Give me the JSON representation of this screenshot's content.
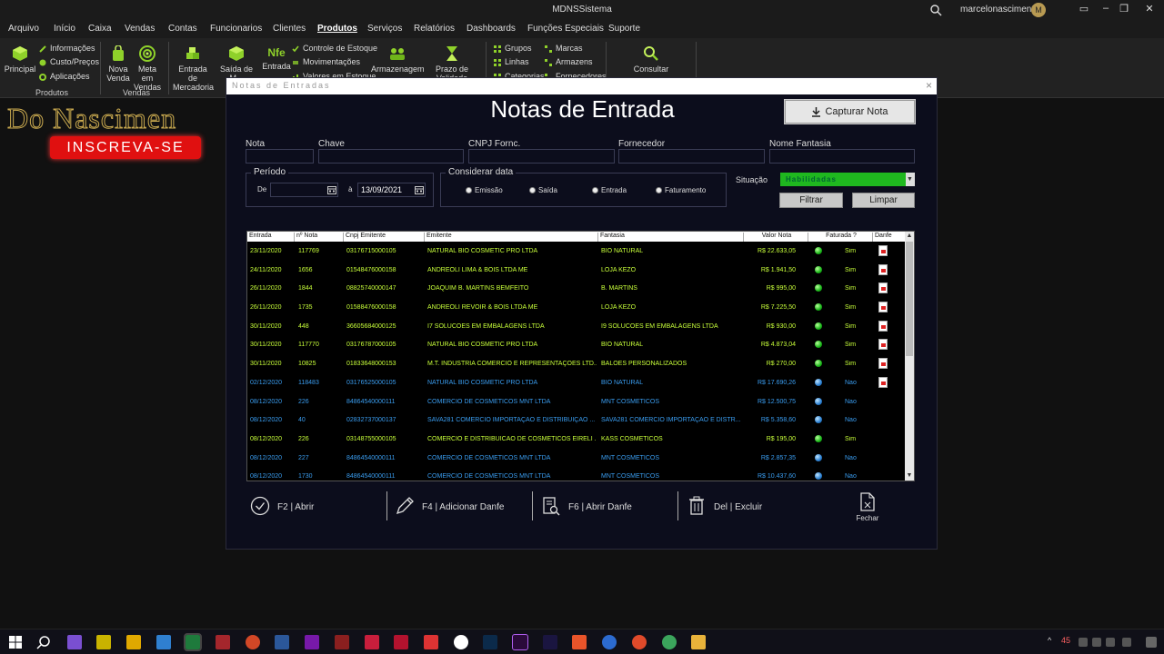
{
  "window": {
    "title": "MDNSSistema",
    "user": "marcelonascimento",
    "avatar_initial": "M",
    "minimize": "–",
    "restore": "❒",
    "close": "✕"
  },
  "menu": [
    "Arquivo",
    "Início",
    "Caixa",
    "Vendas",
    "Contas",
    "Funcionarios",
    "Clientes",
    "Produtos",
    "Serviços",
    "Relatórios",
    "Dashboards",
    "Funções Especiais",
    "Suporte"
  ],
  "menu_active": "Produtos",
  "ribbon": {
    "principal": "Principal",
    "informacoes": "Informações",
    "custo_precos": "Custo/Preços",
    "aplicacoes": "Aplicações",
    "group_produtos": "Produtos",
    "nova_venda": "Nova Venda",
    "meta_vendas": "Meta em Vendas",
    "group_vendas": "Vendas",
    "entrada_mercadoria": "Entrada de Mercadoria",
    "saida_mercadoria": "Saída de M...",
    "nfe_badge": "Nfe",
    "entrada_nfe": "Entrada",
    "controle_estoque": "Controle de Estoque",
    "movimentacoes": "Movimentações",
    "valores_estoque": "Valores em Estoque",
    "armazenagem": "Armazenagem",
    "prazo_validade": "Prazo de Validade",
    "grupos": "Grupos",
    "linhas": "Linhas",
    "categorias": "Categorias",
    "marcas": "Marcas",
    "armazens": "Armazens",
    "fornecedores": "Fornecedores",
    "consultar": "Consultar"
  },
  "banner": {
    "text": "Do Nascimen",
    "button": "INSCREVA-SE"
  },
  "modal": {
    "title": "Notas de Entradas",
    "heading": "Notas de Entrada",
    "capture_button": "Capturar Nota",
    "close": "×"
  },
  "filters": {
    "nota_label": "Nota",
    "chave_label": "Chave",
    "cnpj_label": "CNPJ Fornc.",
    "fornecedor_label": "Fornecedor",
    "nome_fantasia_label": "Nome Fantasia",
    "periodo_legend": "Período",
    "de_label": "De",
    "ate_label": "à",
    "date_from": "",
    "date_to": "13/09/2021",
    "considerar_legend": "Considerar data",
    "radio_emissao": "Emissão",
    "radio_saida": "Saída",
    "radio_entrada": "Entrada",
    "radio_faturamento": "Faturamento",
    "situacao_label": "Situação",
    "situacao_value": "Habilidadas",
    "filtrar": "Filtrar",
    "limpar": "Limpar"
  },
  "grid": {
    "columns": [
      "Entrada",
      "nº Nota",
      "Cnpj Emitente",
      "Emitente",
      "Fantasia",
      "Valor Nota",
      "Faturada ?",
      "Danfe"
    ],
    "rows": [
      {
        "entrada": "23/11/2020",
        "nota": "117769",
        "cnpj": "03176715000105",
        "emitente": "NATURAL BIO COSMETIC PRO LTDA",
        "fantasia": "BIO NATURAL",
        "valor": "R$ 22.633,05",
        "faturada": "Sim",
        "status": "sim",
        "danfe": true
      },
      {
        "entrada": "24/11/2020",
        "nota": "1656",
        "cnpj": "01548476000158",
        "emitente": "ANDREOLI LIMA & BOIS LTDA ME",
        "fantasia": "LOJA KEZO",
        "valor": "R$ 1.941,50",
        "faturada": "Sim",
        "status": "sim",
        "danfe": true
      },
      {
        "entrada": "26/11/2020",
        "nota": "1844",
        "cnpj": "08825740000147",
        "emitente": "JOAQUIM B. MARTINS BEMFEITO",
        "fantasia": "B. MARTINS",
        "valor": "R$ 995,00",
        "faturada": "Sim",
        "status": "sim",
        "danfe": true
      },
      {
        "entrada": "26/11/2020",
        "nota": "1735",
        "cnpj": "01588476000158",
        "emitente": "ANDREOLI REVOIR & BOIS LTDA ME",
        "fantasia": "LOJA KEZO",
        "valor": "R$ 7.225,50",
        "faturada": "Sim",
        "status": "sim",
        "danfe": true
      },
      {
        "entrada": "30/11/2020",
        "nota": "448",
        "cnpj": "36605684000125",
        "emitente": "I7 SOLUCOES EM EMBALAGENS LTDA",
        "fantasia": "I9 SOLUCOES EM EMBALAGENS LTDA",
        "valor": "R$ 930,00",
        "faturada": "Sim",
        "status": "sim",
        "danfe": true
      },
      {
        "entrada": "30/11/2020",
        "nota": "117770",
        "cnpj": "03176787000105",
        "emitente": "NATURAL BIO COSMETIC PRO LTDA",
        "fantasia": "BIO NATURAL",
        "valor": "R$ 4.873,04",
        "faturada": "Sim",
        "status": "sim",
        "danfe": true
      },
      {
        "entrada": "30/11/2020",
        "nota": "10825",
        "cnpj": "01833648000153",
        "emitente": "M.T. INDUSTRIA COMERCIO E REPRESENTAÇÕES LTD...",
        "fantasia": "BALOES PERSONALIZADOS",
        "valor": "R$ 270,00",
        "faturada": "Sim",
        "status": "sim",
        "danfe": true
      },
      {
        "entrada": "02/12/2020",
        "nota": "118483",
        "cnpj": "03176525000105",
        "emitente": "NATURAL BIO COSMETIC PRO LTDA",
        "fantasia": "BIO NATURAL",
        "valor": "R$ 17.690,26",
        "faturada": "Nao",
        "status": "nao",
        "danfe": true
      },
      {
        "entrada": "08/12/2020",
        "nota": "226",
        "cnpj": "84864540000111",
        "emitente": "COMERCIO DE COSMETICOS MNT LTDA",
        "fantasia": "MNT COSMETICOS",
        "valor": "R$ 12.500,75",
        "faturada": "Nao",
        "status": "nao",
        "danfe": false
      },
      {
        "entrada": "08/12/2020",
        "nota": "40",
        "cnpj": "02832737000137",
        "emitente": "SAVA281 COMERCIO IMPORTAÇÃO E DISTRIBUIÇÃO ...",
        "fantasia": "SAVA281 COMERCIO IMPORTAÇÃO E DISTR...",
        "valor": "R$ 5.358,60",
        "faturada": "Nao",
        "status": "nao",
        "danfe": false
      },
      {
        "entrada": "08/12/2020",
        "nota": "226",
        "cnpj": "03148755000105",
        "emitente": "COMERCIO E DISTRIBUICAO DE COSMETICOS EIRELI ...",
        "fantasia": "KASS COSMETICOS",
        "valor": "R$ 195,00",
        "faturada": "Sim",
        "status": "sim",
        "danfe": false
      },
      {
        "entrada": "08/12/2020",
        "nota": "227",
        "cnpj": "84864540000111",
        "emitente": "COMERCIO DE COSMETICOS MNT LTDA",
        "fantasia": "MNT COSMETICOS",
        "valor": "R$ 2.857,35",
        "faturada": "Nao",
        "status": "nao",
        "danfe": false
      },
      {
        "entrada": "08/12/2020",
        "nota": "1730",
        "cnpj": "84864540000111",
        "emitente": "COMERCIO DE COSMETICOS MNT LTDA",
        "fantasia": "MNT COSMETICOS",
        "valor": "R$ 10.437,60",
        "faturada": "Nao",
        "status": "nao",
        "danfe": false
      }
    ]
  },
  "actions": {
    "abrir": "F2  |  Abrir",
    "adicionar_danfe": "F4  |  Adicionar Danfe",
    "abrir_danfe": "F6  |  Abrir Danfe",
    "excluir": "Del  |  Excluir",
    "fechar": "Fechar"
  },
  "taskbar": {
    "notification_count": "45"
  },
  "colors": {
    "sim_text": "#c8ff3a",
    "nao_text": "#3a9df0",
    "situacao_bg": "#1fb81f",
    "banner_red": "#e01010"
  }
}
